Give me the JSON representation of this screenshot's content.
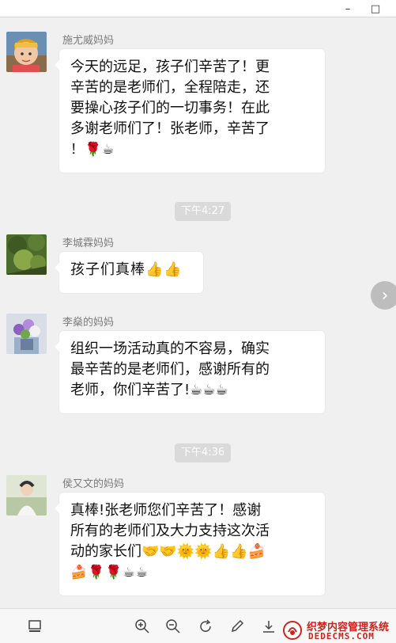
{
  "window": {
    "minimize_label": "–",
    "maximize_label": "□"
  },
  "messages": [
    {
      "sender": "施尤威妈妈",
      "lines": [
        "今天的远足，孩子们辛苦了！更",
        "辛苦的是老师们，全程陪走，还",
        "要操心孩子们的一切事务！在此",
        "多谢老师们了！张老师，辛苦了"
      ],
      "last": "！🌹☕"
    },
    {
      "sender": "李城霖妈妈",
      "lines": [
        "孩子们真棒👍👍"
      ]
    },
    {
      "sender": "李燊的妈妈",
      "lines": [
        "组织一场活动真的不容易，确实",
        "最辛苦的是老师们，感谢所有的",
        "老师，你们辛苦了!☕☕☕"
      ]
    },
    {
      "sender": "侯又文的妈妈",
      "lines": [
        "真棒!张老师您们辛苦了！感谢",
        "所有的老师们及大力支持这次活",
        "动的家长们🤝🤝🌞🌞👍👍🍰"
      ],
      "last": "🍰🌹🌹☕☕"
    }
  ],
  "timestamps": [
    "下午4:27",
    "下午4:36"
  ],
  "toolbar": {
    "icons": [
      "thumbnail-icon",
      "zoom-in-icon",
      "zoom-out-icon",
      "rotate-icon",
      "edit-icon",
      "download-icon"
    ]
  },
  "watermark": {
    "line1": "织梦内容管理系统",
    "line2": "DEDECMS.COM"
  },
  "colors": {
    "chat_bg": "#f0f0f0",
    "bubble": "#ffffff",
    "timestamp_bg": "#dadada",
    "watermark_red": "#d0221c"
  }
}
